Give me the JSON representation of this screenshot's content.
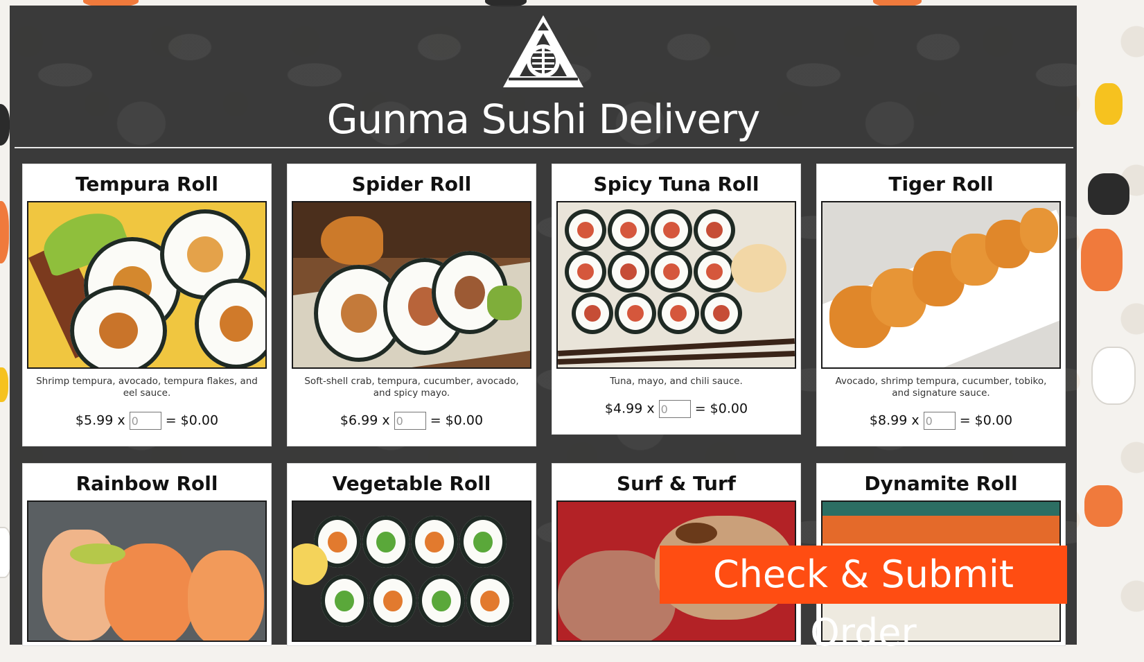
{
  "site": {
    "title": "Gunma Sushi Delivery"
  },
  "menu": [
    {
      "name": "Tempura Roll",
      "description": "Shrimp tempura, avocado, tempura flakes, and eel sauce.",
      "price": "$5.99",
      "times": "x",
      "qty_placeholder": "0",
      "equals": "=",
      "total": "$0.00"
    },
    {
      "name": "Spider Roll",
      "description": "Soft-shell crab, tempura, cucumber, avocado, and spicy mayo.",
      "price": "$6.99",
      "times": "x",
      "qty_placeholder": "0",
      "equals": "=",
      "total": "$0.00"
    },
    {
      "name": "Spicy Tuna Roll",
      "description": "Tuna, mayo, and chili sauce.",
      "price": "$4.99",
      "times": "x",
      "qty_placeholder": "0",
      "equals": "=",
      "total": "$0.00"
    },
    {
      "name": "Tiger Roll",
      "description": "Avocado, shrimp tempura, cucumber, tobiko, and signature sauce.",
      "price": "$8.99",
      "times": "x",
      "qty_placeholder": "0",
      "equals": "=",
      "total": "$0.00"
    },
    {
      "name": "Rainbow Roll"
    },
    {
      "name": "Vegetable Roll"
    },
    {
      "name": "Surf & Turf"
    },
    {
      "name": "Dynamite Roll"
    }
  ],
  "actions": {
    "submit_label": "Check & Submit Order"
  },
  "colors": {
    "panel": "#343434",
    "accent": "#ff4d12",
    "card": "#ffffff"
  },
  "icons": {
    "logo": "triangle-emblem-logo"
  }
}
